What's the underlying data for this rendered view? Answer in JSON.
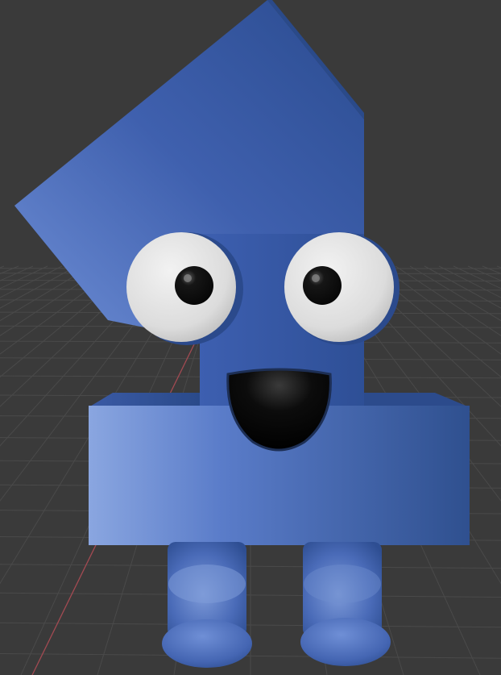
{
  "scene": {
    "subject": "number-one-character",
    "colors": {
      "background": "#3a3a3a",
      "grid_line": "#4b4b4b",
      "axis_x_line": "#a24a52",
      "body_light": "#8aa6e0",
      "body_mid": "#4d6fbd",
      "body_dark": "#2a4a8a",
      "eye_white": "#e6e6e6",
      "pupil": "#0e0e0e",
      "mouth": "#050505"
    }
  }
}
